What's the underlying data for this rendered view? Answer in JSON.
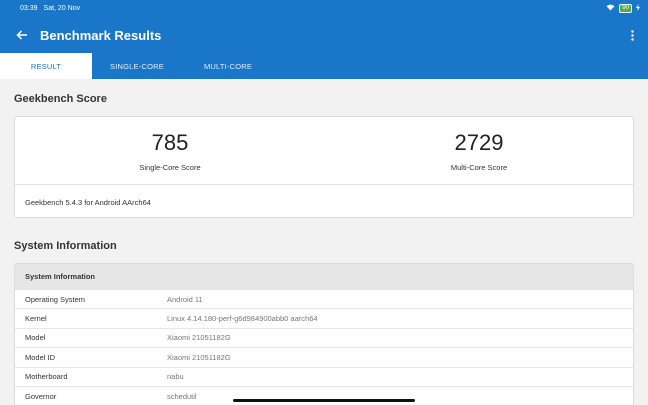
{
  "status": {
    "time": "03:39",
    "date": "Sat, 20 Nov",
    "battery": "90"
  },
  "appbar": {
    "title": "Benchmark Results"
  },
  "tabs": [
    {
      "label": "RESULT",
      "active": true
    },
    {
      "label": "SINGLE-CORE",
      "active": false
    },
    {
      "label": "MULTI-CORE",
      "active": false
    }
  ],
  "geekbench": {
    "heading": "Geekbench Score",
    "single_score": "785",
    "single_label": "Single-Core Score",
    "multi_score": "2729",
    "multi_label": "Multi-Core Score",
    "version": "Geekbench 5.4.3 for Android AArch64"
  },
  "system": {
    "heading": "System Information",
    "table_header": "System Information",
    "rows": [
      {
        "key": "Operating System",
        "value": "Android 11"
      },
      {
        "key": "Kernel",
        "value": "Linux 4.14.180-perf-g6d984900abb0 aarch64"
      },
      {
        "key": "Model",
        "value": "Xiaomi 21051182G"
      },
      {
        "key": "Model ID",
        "value": "Xiaomi 21051182G"
      },
      {
        "key": "Motherboard",
        "value": "nabu"
      },
      {
        "key": "Governor",
        "value": "schedutil"
      }
    ]
  },
  "colors": {
    "primary": "#1976c8",
    "background": "#f2f2f2"
  }
}
